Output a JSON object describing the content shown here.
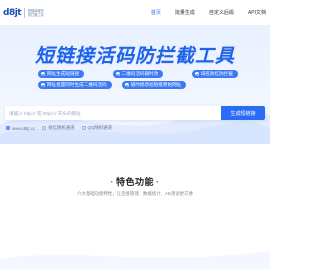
{
  "logo": {
    "mark": "d8jt",
    "line1": "短链接服务",
    "line2": "防拦截工具"
  },
  "nav": [
    {
      "label": "首页",
      "active": true
    },
    {
      "label": "批量生成",
      "active": false
    },
    {
      "label": "自定义后缀",
      "active": false
    },
    {
      "label": "API文档",
      "active": false
    }
  ],
  "hero": {
    "title": "短链接活码防拦截工具",
    "features": [
      [
        "网址生成短链接",
        "二维码活码随时改",
        "域名防红防拦截"
      ],
      [
        "网址批量同时生成二维码活码",
        "随时修改短链接原始网址"
      ]
    ],
    "search": {
      "placeholder": "请输入 http:// 或 https:// 开头的网址",
      "button": "生成短链接"
    },
    "options": [
      {
        "label": "www.d8jt.cc",
        "selected": true
      },
      {
        "label": "微信随机通道",
        "selected": false
      },
      {
        "label": "QQ随机通道",
        "selected": false
      }
    ]
  },
  "section": {
    "title": "特色功能",
    "desc": "六大基础功能特性，让连接管理、数据统计、AB测试更方便"
  },
  "colors": {
    "accent": "#2a6df4",
    "hero_bg": "#e9f1ff",
    "title": "#1e63e9"
  }
}
